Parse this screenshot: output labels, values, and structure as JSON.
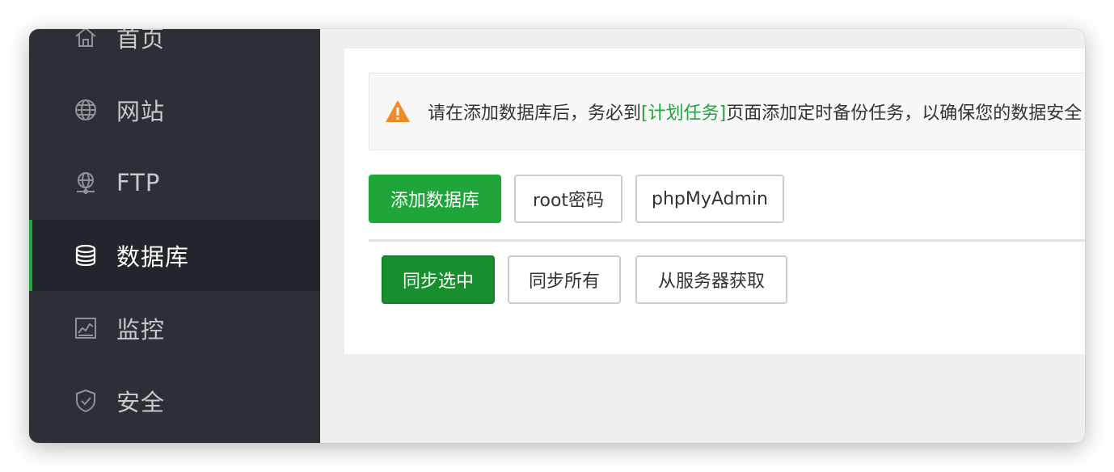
{
  "sidebar": {
    "items": [
      {
        "label": "首页",
        "icon": "home-icon"
      },
      {
        "label": "网站",
        "icon": "globe-icon"
      },
      {
        "label": "FTP",
        "icon": "ftp-icon"
      },
      {
        "label": "数据库",
        "icon": "database-icon",
        "active": true
      },
      {
        "label": "监控",
        "icon": "monitor-chart-icon"
      },
      {
        "label": "安全",
        "icon": "shield-icon"
      }
    ]
  },
  "notice": {
    "icon": "warning-icon",
    "before": "请在添加数据库后，务必到",
    "link": "[计划任务]",
    "after": "页面添加定时备份任务，以确保您的数据安全"
  },
  "toolbar": {
    "add_database": "添加数据库",
    "root_password": "root密码",
    "phpmyadmin": "phpMyAdmin"
  },
  "sync_bar": {
    "sync_selected": "同步选中",
    "sync_all": "同步所有",
    "fetch_from_server": "从服务器获取"
  },
  "colors": {
    "accent": "#20a53a",
    "sidebar_bg": "#2c2f36",
    "warning": "#f08a24"
  }
}
